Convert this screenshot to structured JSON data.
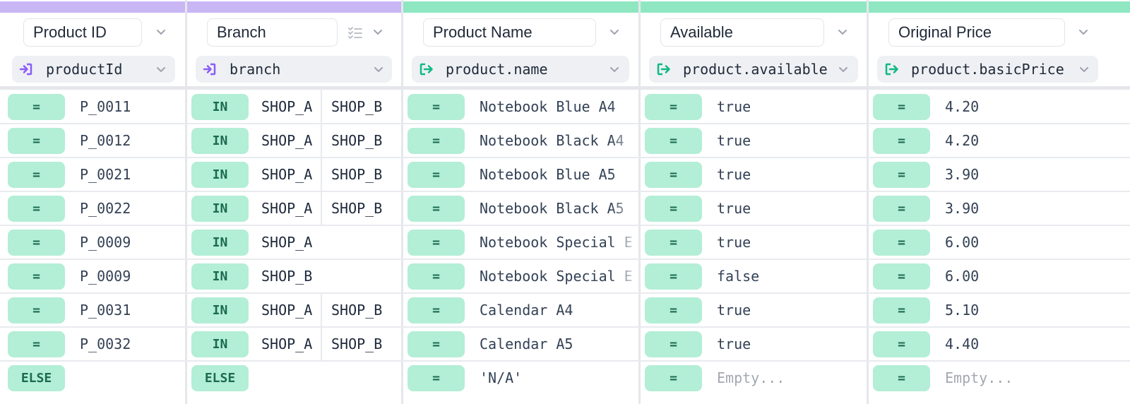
{
  "columns": [
    {
      "title": "Product ID",
      "expression": "productId",
      "kind": "input"
    },
    {
      "title": "Branch",
      "expression": "branch",
      "kind": "input"
    },
    {
      "title": "Product Name",
      "expression": "product.name",
      "kind": "output"
    },
    {
      "title": "Available",
      "expression": "product.available",
      "kind": "output"
    },
    {
      "title": "Original Price",
      "expression": "product.basicPrice",
      "kind": "output"
    }
  ],
  "rows": [
    {
      "pid_op": "=",
      "pid": "P_0011",
      "branch_op": "IN",
      "branch_a": "SHOP_A",
      "branch_b": "SHOP_B",
      "name_op": "=",
      "name": "Notebook Blue A4",
      "avail_op": "=",
      "avail": "true",
      "price_op": "=",
      "price": "4.20"
    },
    {
      "pid_op": "=",
      "pid": "P_0012",
      "branch_op": "IN",
      "branch_a": "SHOP_A",
      "branch_b": "SHOP_B",
      "name_op": "=",
      "name": "Notebook Black A4",
      "avail_op": "=",
      "avail": "true",
      "price_op": "=",
      "price": "4.20"
    },
    {
      "pid_op": "=",
      "pid": "P_0021",
      "branch_op": "IN",
      "branch_a": "SHOP_A",
      "branch_b": "SHOP_B",
      "name_op": "=",
      "name": "Notebook Blue A5",
      "avail_op": "=",
      "avail": "true",
      "price_op": "=",
      "price": "3.90"
    },
    {
      "pid_op": "=",
      "pid": "P_0022",
      "branch_op": "IN",
      "branch_a": "SHOP_A",
      "branch_b": "SHOP_B",
      "name_op": "=",
      "name": "Notebook Black A5",
      "avail_op": "=",
      "avail": "true",
      "price_op": "=",
      "price": "3.90"
    },
    {
      "pid_op": "=",
      "pid": "P_0009",
      "branch_op": "IN",
      "branch_a": "SHOP_A",
      "branch_b": "",
      "name_op": "=",
      "name": "Notebook Special E",
      "avail_op": "=",
      "avail": "true",
      "price_op": "=",
      "price": "6.00"
    },
    {
      "pid_op": "=",
      "pid": "P_0009",
      "branch_op": "IN",
      "branch_a": "SHOP_B",
      "branch_b": "",
      "name_op": "=",
      "name": "Notebook Special E",
      "avail_op": "=",
      "avail": "false",
      "price_op": "=",
      "price": "6.00"
    },
    {
      "pid_op": "=",
      "pid": "P_0031",
      "branch_op": "IN",
      "branch_a": "SHOP_A",
      "branch_b": "SHOP_B",
      "name_op": "=",
      "name": "Calendar A4",
      "avail_op": "=",
      "avail": "true",
      "price_op": "=",
      "price": "5.10"
    },
    {
      "pid_op": "=",
      "pid": "P_0032",
      "branch_op": "IN",
      "branch_a": "SHOP_A",
      "branch_b": "SHOP_B",
      "name_op": "=",
      "name": "Calendar A5",
      "avail_op": "=",
      "avail": "true",
      "price_op": "=",
      "price": "4.40"
    },
    {
      "pid_op": "ELSE",
      "pid": "",
      "branch_op": "ELSE",
      "branch_a": "",
      "branch_b": "",
      "name_op": "=",
      "name": "'N/A'",
      "avail_op": "=",
      "avail": "Empty...",
      "price_op": "=",
      "price": "Empty..."
    }
  ],
  "colors": {
    "input_accent": "#c9b6f5",
    "output_accent": "#8fe7c1",
    "pill_bg": "#b3eed6",
    "pill_text": "#1b6b50"
  },
  "icons": {
    "input": "input-arrow-icon",
    "output": "output-arrow-icon",
    "dropdown": "chevron-down-icon",
    "list": "checklist-icon"
  }
}
